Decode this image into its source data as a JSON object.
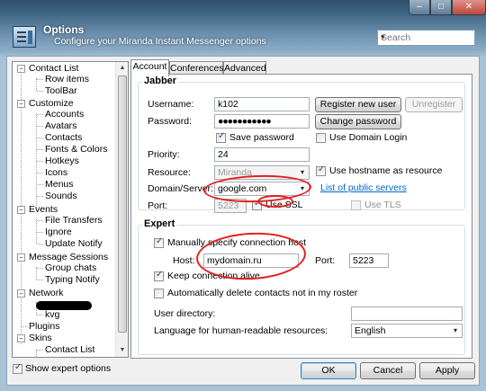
{
  "window": {
    "title": "Options",
    "subtitle": "Configure your Miranda Instant Messenger options",
    "controls": {
      "minimize": "–",
      "maximize": "□",
      "close": "✕"
    },
    "search": {
      "placeholder": "Search",
      "dropdown": "▾"
    }
  },
  "tree": {
    "expander_open": "−",
    "expander_closed": "+",
    "items": [
      {
        "label": "Contact List"
      },
      {
        "label": "Row items"
      },
      {
        "label": "ToolBar"
      },
      {
        "label": "Customize"
      },
      {
        "label": "Accounts"
      },
      {
        "label": "Avatars"
      },
      {
        "label": "Contacts"
      },
      {
        "label": "Fonts & Colors"
      },
      {
        "label": "Hotkeys"
      },
      {
        "label": "Icons"
      },
      {
        "label": "Menus"
      },
      {
        "label": "Sounds"
      },
      {
        "label": "Events"
      },
      {
        "label": "File Transfers"
      },
      {
        "label": "Ignore"
      },
      {
        "label": "Update Notify"
      },
      {
        "label": "Message Sessions"
      },
      {
        "label": "Group chats"
      },
      {
        "label": "Typing Notify"
      },
      {
        "label": "Network"
      },
      {
        "label": "kvg"
      },
      {
        "label": "Plugins"
      },
      {
        "label": "Skins"
      },
      {
        "label": "Contact List"
      }
    ],
    "scroll_up": "▲",
    "scroll_down": "▼"
  },
  "tabs": [
    {
      "label": "Account",
      "active": true
    },
    {
      "label": "Conferences",
      "active": false
    },
    {
      "label": "Advanced",
      "active": false
    }
  ],
  "jabber": {
    "title": "Jabber",
    "username_label": "Username:",
    "username_value": "k102",
    "password_label": "Password:",
    "password_value": "●●●●●●●●●●●",
    "save_password_label": "Save password",
    "save_password_checked": true,
    "register_button": "Register new user",
    "unregister_button": "Unregister",
    "change_password_button": "Change password",
    "use_domain_login_label": "Use Domain Login",
    "use_domain_login_checked": false,
    "priority_label": "Priority:",
    "priority_value": "24",
    "resource_label": "Resource:",
    "resource_value": "Miranda",
    "use_hostname_label": "Use hostname as resource",
    "use_hostname_checked": true,
    "domain_label": "Domain/Server:",
    "domain_value": "google.com",
    "public_servers_link": "List of public servers",
    "port_label": "Port:",
    "port_value": "5223",
    "use_ssl_label": "Use SSL",
    "use_ssl_checked": true,
    "use_tls_label": "Use TLS",
    "use_tls_checked": false
  },
  "expert": {
    "title": "Expert",
    "manual_host_label": "Manually specify connection host",
    "manual_host_checked": true,
    "host_label": "Host:",
    "host_value": "mydomain.ru",
    "port_label": "Port:",
    "port_value": "5223",
    "keep_alive_label": "Keep connection alive",
    "keep_alive_checked": true,
    "auto_delete_label": "Automatically delete contacts not in my roster",
    "auto_delete_checked": false,
    "user_directory_label": "User directory:",
    "user_directory_value": "",
    "language_label": "Language for human-readable resources:",
    "language_value": "English"
  },
  "footer": {
    "show_expert_label": "Show expert options",
    "show_expert_checked": true,
    "ok_button": "OK",
    "cancel_button": "Cancel",
    "apply_button": "Apply"
  },
  "colors": {
    "annotation_red": "#e31f1f",
    "link_blue": "#0066cc",
    "title_gradient": "#3f6584"
  }
}
